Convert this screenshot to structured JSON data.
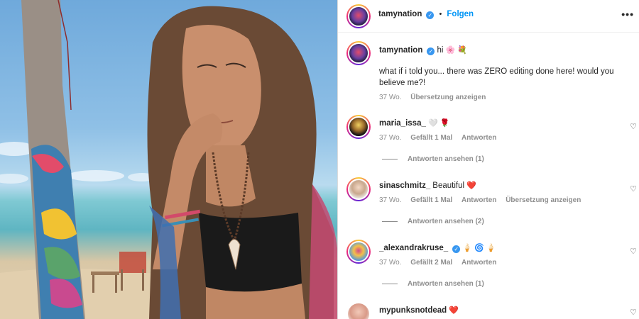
{
  "post": {
    "username": "tamynation",
    "follow_label": "Folgen",
    "more_label": "•••",
    "caption_title": "hi",
    "caption_emoji": "🌸 💐",
    "caption_text": "what if i told you... there was ZERO editing done here! would you believe me?!",
    "caption_age": "37 Wo.",
    "caption_translate": "Übersetzung anzeigen"
  },
  "comments": [
    {
      "username": "maria_issa_",
      "text": "",
      "emoji": "🤍 🌹",
      "verified": false,
      "age": "37 Wo.",
      "likes": "Gefällt 1 Mal",
      "reply": "Antworten",
      "translate": "",
      "replies": "Antworten ansehen (1)"
    },
    {
      "username": "sinaschmitz_",
      "text": "Beautiful",
      "emoji": "❤️",
      "verified": false,
      "age": "37 Wo.",
      "likes": "Gefällt 1 Mal",
      "reply": "Antworten",
      "translate": "Übersetzung anzeigen",
      "replies": "Antworten ansehen (2)"
    },
    {
      "username": "_alexandrakruse_",
      "text": "",
      "emoji": "🍦 🌀 🍦",
      "verified": true,
      "age": "37 Wo.",
      "likes": "Gefällt 2 Mal",
      "reply": "Antworten",
      "translate": "",
      "replies": "Antworten ansehen (1)"
    },
    {
      "username": "mypunksnotdead",
      "text": "",
      "emoji": "❤️",
      "verified": false,
      "age": "",
      "likes": "",
      "reply": "",
      "translate": "",
      "replies": ""
    }
  ],
  "icons": {
    "heart": "♡",
    "verified": "✓"
  }
}
